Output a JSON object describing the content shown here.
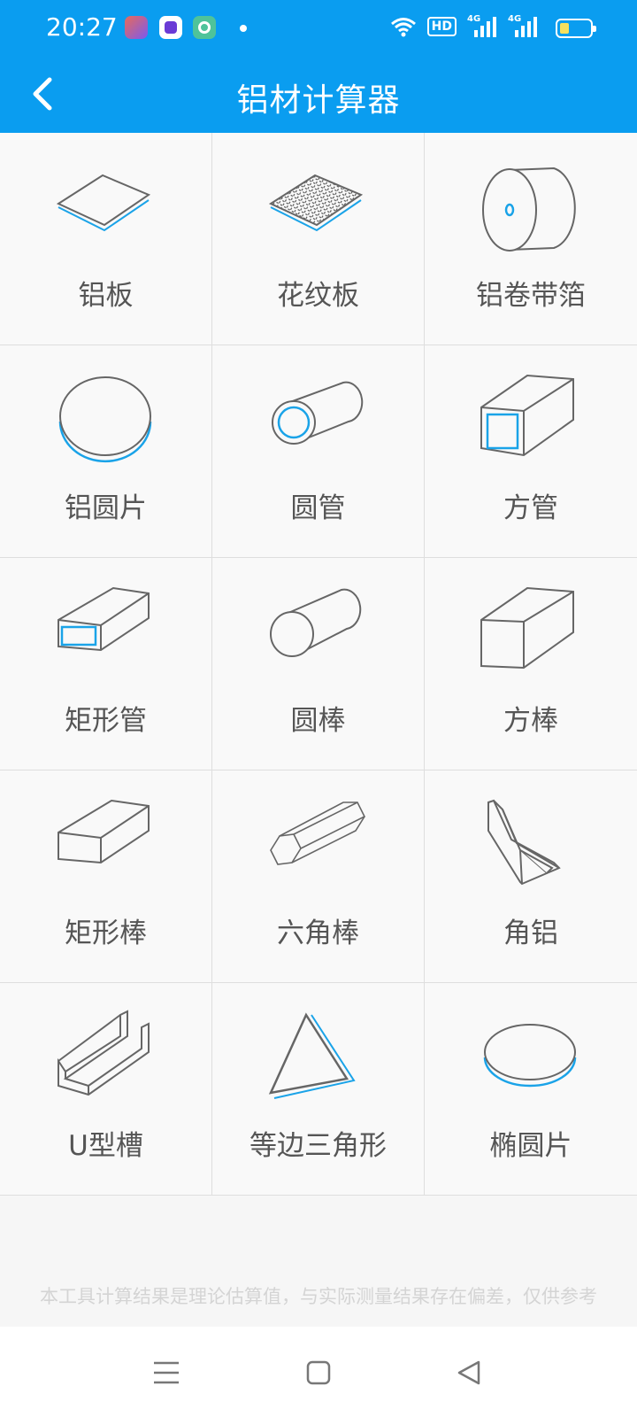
{
  "status_bar": {
    "time": "20:27",
    "hd_label": "HD",
    "network_1": "4G",
    "network_2": "4G"
  },
  "header": {
    "title": "铝材计算器"
  },
  "items": [
    {
      "label": "铝板",
      "icon": "aluminum-plate-icon"
    },
    {
      "label": "花纹板",
      "icon": "checker-plate-icon"
    },
    {
      "label": "铝卷带箔",
      "icon": "coil-foil-icon"
    },
    {
      "label": "铝圆片",
      "icon": "round-disc-icon"
    },
    {
      "label": "圆管",
      "icon": "round-tube-icon"
    },
    {
      "label": "方管",
      "icon": "square-tube-icon"
    },
    {
      "label": "矩形管",
      "icon": "rect-tube-icon"
    },
    {
      "label": "圆棒",
      "icon": "round-bar-icon"
    },
    {
      "label": "方棒",
      "icon": "square-bar-icon"
    },
    {
      "label": "矩形棒",
      "icon": "rect-bar-icon"
    },
    {
      "label": "六角棒",
      "icon": "hex-bar-icon"
    },
    {
      "label": "角铝",
      "icon": "angle-aluminum-icon"
    },
    {
      "label": "U型槽",
      "icon": "u-channel-icon"
    },
    {
      "label": "等边三角形",
      "icon": "triangle-icon"
    },
    {
      "label": "椭圆片",
      "icon": "ellipse-disc-icon"
    }
  ],
  "footer": {
    "disclaimer": "本工具计算结果是理论估算值，与实际测量结果存在偏差，仅供参考"
  },
  "colors": {
    "primary": "#0a9df0",
    "accent_line": "#1aa3e8",
    "icon_stroke": "#666666"
  }
}
